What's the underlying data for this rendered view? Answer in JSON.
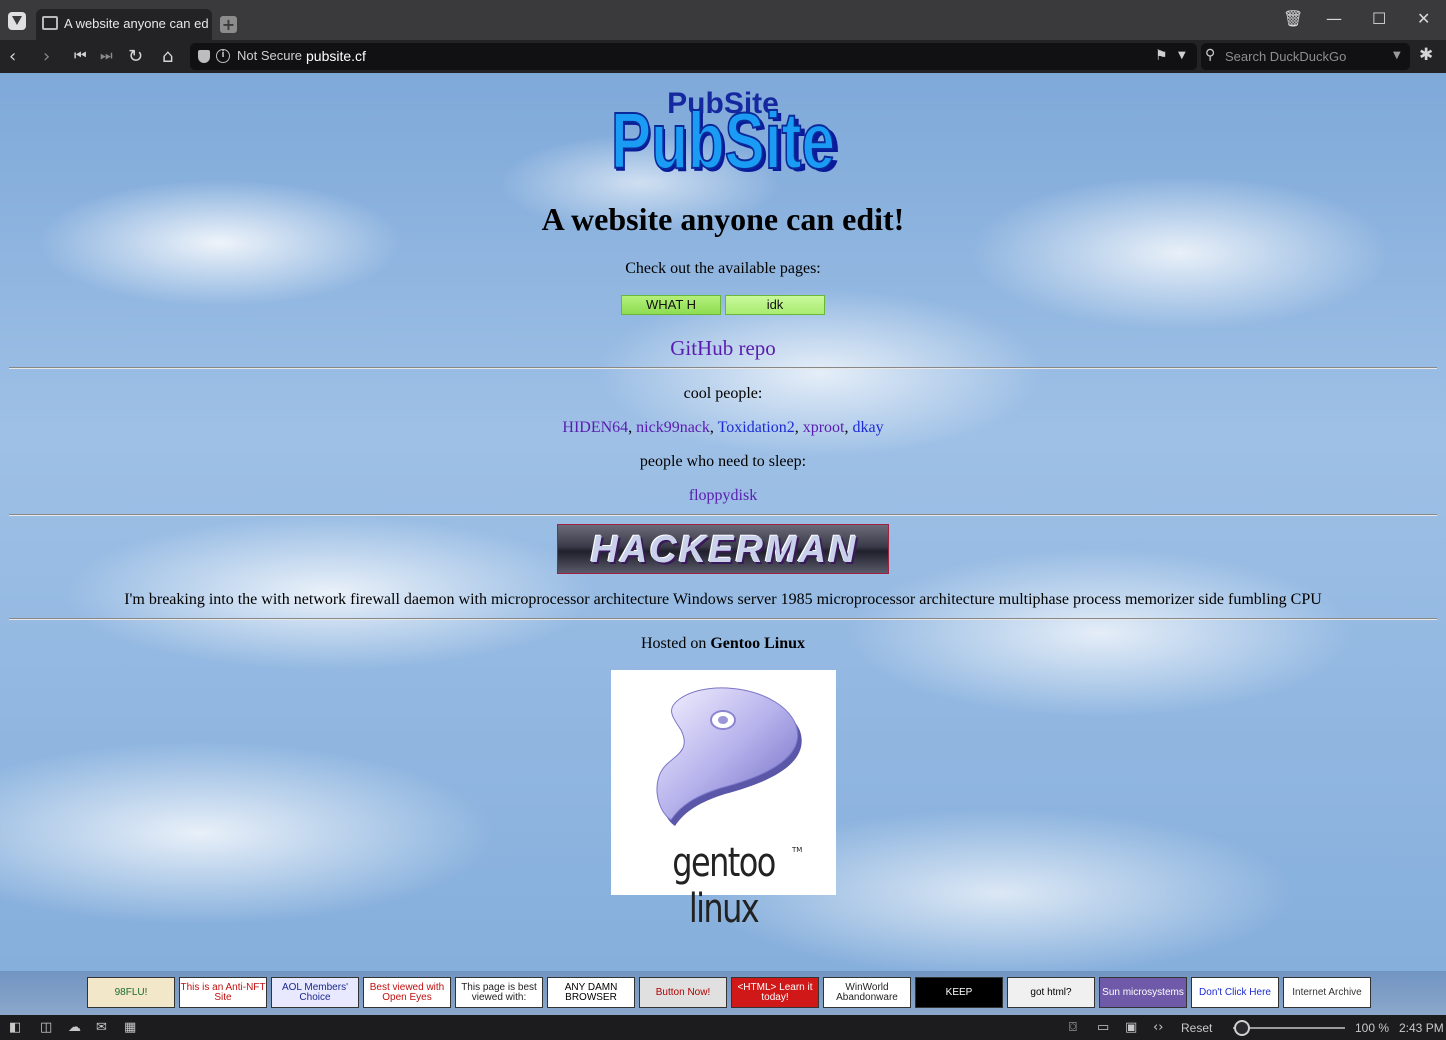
{
  "browser": {
    "tab_title": "A website anyone can edit!",
    "new_tab_label": "+",
    "security_label": "Not Secure",
    "url": "pubsite.cf",
    "search_placeholder": "Search DuckDuckGo"
  },
  "page": {
    "logo_text": "PubSite",
    "headline": "A website anyone can edit!",
    "pages_intro": "Check out the available pages:",
    "page_buttons": [
      "WHAT H",
      "idk"
    ],
    "github_link": "GitHub repo",
    "cool_people_label": "cool people:",
    "cool_people": [
      "HIDEN64",
      "nick99nack",
      "Toxidation2",
      "xproot",
      "dkay"
    ],
    "sleep_label": "people who need to sleep:",
    "sleep_people": [
      "floppydisk"
    ],
    "hackerman_banner": "HACKERMAN",
    "hacker_text": "I'm breaking into the with network firewall daemon with microprocessor architecture Windows server 1985 microprocessor architecture multiphase process memorizer side fumbling CPU",
    "hosted_prefix": "Hosted on ",
    "hosted_os": "Gentoo Linux",
    "gentoo_logo_text": "gentoo linux",
    "gentoo_tm": "TM"
  },
  "badges": [
    {
      "label": "98FLU!",
      "bg": "#f2e7c8",
      "fg": "#1a6b2a"
    },
    {
      "label": "This is an Anti-NFT Site",
      "bg": "#ffffff",
      "fg": "#c01010"
    },
    {
      "label": "AOL Members' Choice",
      "bg": "#e8e8ff",
      "fg": "#1a2a8a"
    },
    {
      "label": "Best viewed with Open Eyes",
      "bg": "#ffffff",
      "fg": "#c01010"
    },
    {
      "label": "This page is best viewed with:",
      "bg": "#ffffff",
      "fg": "#222222"
    },
    {
      "label": "ANY DAMN BROWSER",
      "bg": "#ffffff",
      "fg": "#000000"
    },
    {
      "label": "Button Now!",
      "bg": "#e0e0e0",
      "fg": "#b00000"
    },
    {
      "label": "<HTML> Learn it today!",
      "bg": "#d01818",
      "fg": "#ffffff"
    },
    {
      "label": "WinWorld Abandonware",
      "bg": "#ffffff",
      "fg": "#222222"
    },
    {
      "label": "KEEP",
      "bg": "#000000",
      "fg": "#ffffff"
    },
    {
      "label": "got html?",
      "bg": "#f0f0f0",
      "fg": "#000000"
    },
    {
      "label": "Sun microsystems",
      "bg": "#6e5aa8",
      "fg": "#ffffff"
    },
    {
      "label": "Don't Click Here",
      "bg": "#ffffff",
      "fg": "#1a2ad0"
    },
    {
      "label": "Internet Archive",
      "bg": "#ffffff",
      "fg": "#333333"
    }
  ],
  "statusbar": {
    "reset_label": "Reset",
    "zoom": "100 %",
    "time": "2:43 PM"
  },
  "colors": {
    "link_visited": "#5a1cb0",
    "link_unvisited": "#1c2bd6",
    "logo_fill": "#1a8cf0",
    "page_button": "#a6ea66"
  }
}
